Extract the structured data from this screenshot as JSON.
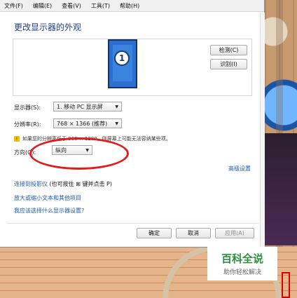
{
  "menu": [
    "文件(F)",
    "编辑(E)",
    "查看(V)",
    "工具(T)",
    "帮助(H)"
  ],
  "title": "更改显示器的外观",
  "monitor_number": "1",
  "buttons": {
    "detect": "检测(C)",
    "identify": "识别(I)",
    "ok": "确定",
    "cancel": "取消",
    "apply": "应用(A)"
  },
  "display": {
    "label": "显示器(S):",
    "value": "1. 移动 PC 显示屏"
  },
  "resolution": {
    "label": "分辨率(R):",
    "value": "768 × 1366 (推荐)"
  },
  "warning": "如果您的分辨率低于 960 × 1280，则屏幕上可能无法容纳某些项。",
  "orientation": {
    "label": "方向(O):",
    "value": "纵向"
  },
  "advanced_link": "高级设置",
  "links": {
    "projector_part1": "连接到投影仪",
    "projector_part2": "(也可按住",
    "projector_part3": "键并点击 P)",
    "text_size": "放大或缩小文本和其他项目",
    "which_settings": "我应该选择什么显示器设置?"
  },
  "watermark": {
    "title": "百科全说",
    "subtitle": "助你轻松解决"
  },
  "colors": {
    "link": "#1b59b5",
    "title": "#1f3f8a",
    "highlight_oval": "#e21b1b",
    "watermark": "#2c8f3b"
  }
}
